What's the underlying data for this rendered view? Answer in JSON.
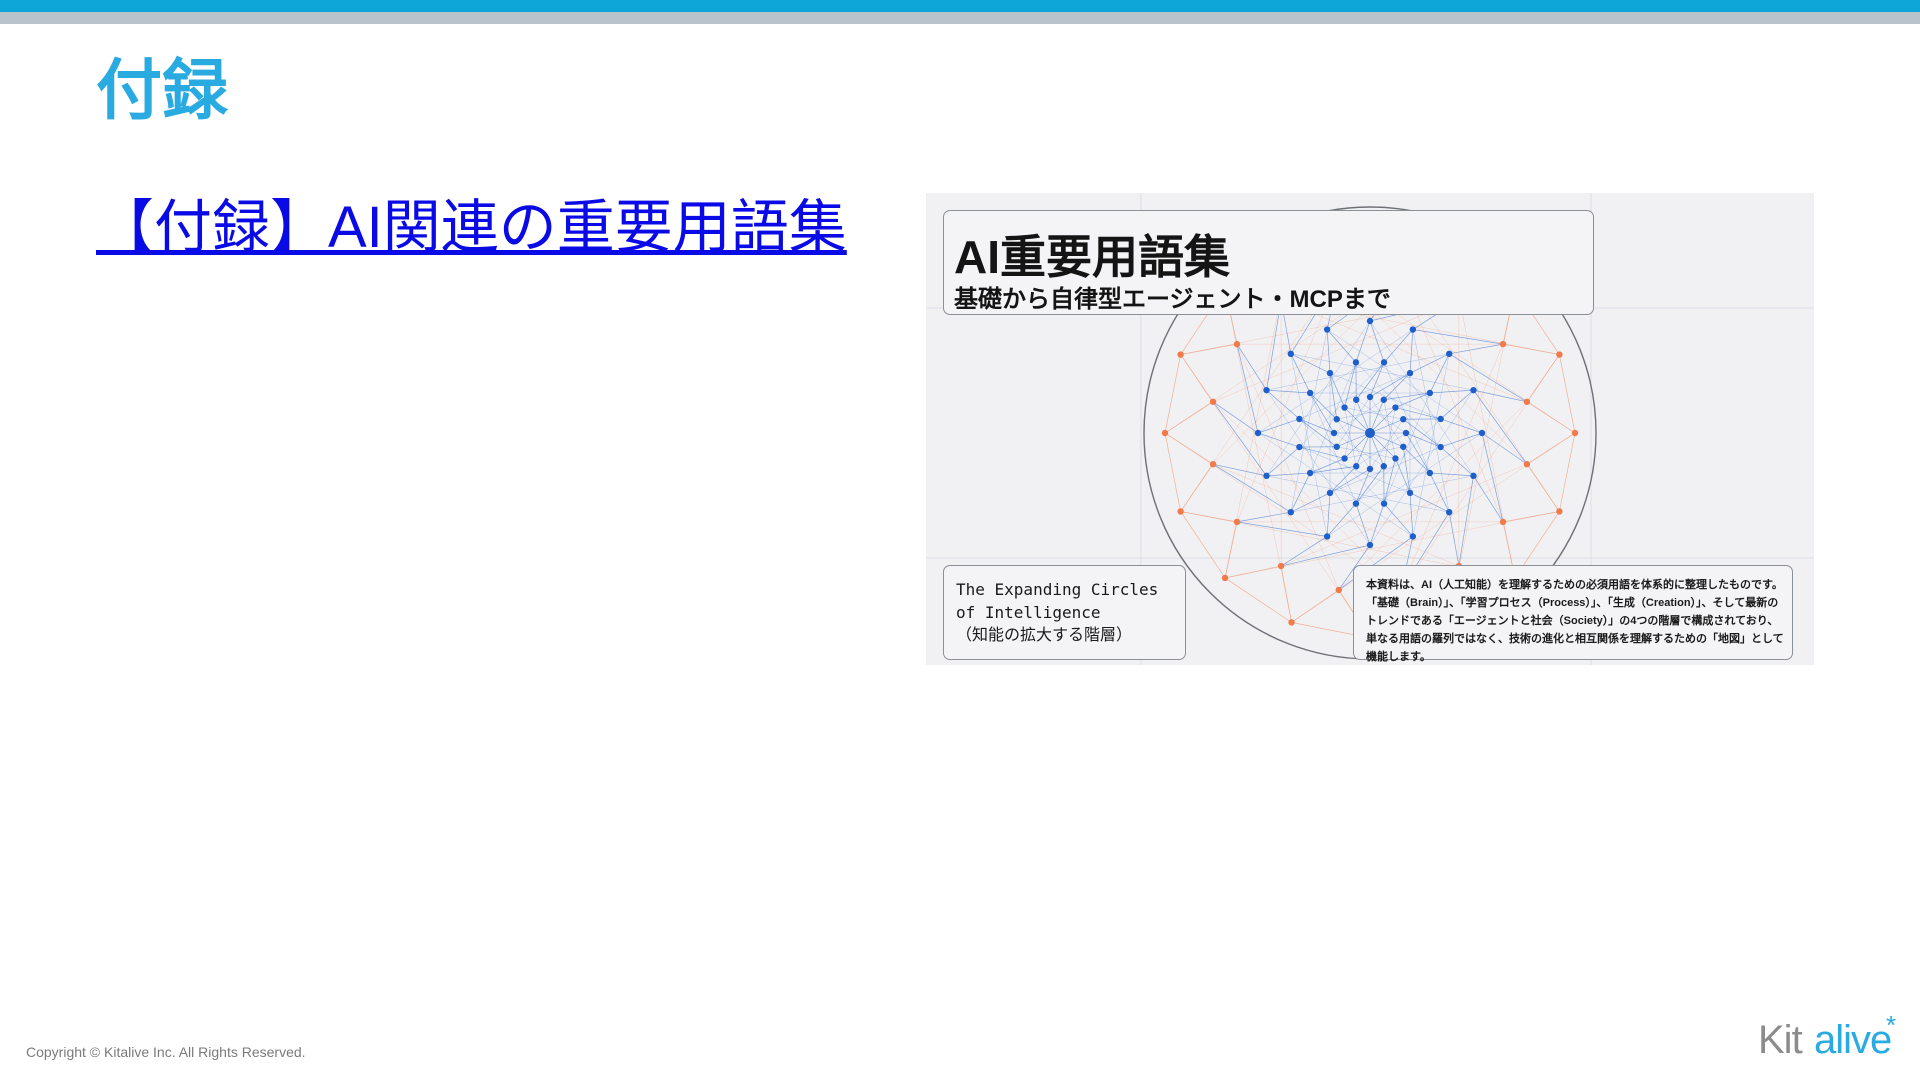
{
  "slide": {
    "title": "付録",
    "link_text": "【付録】AI関連の重要用語集"
  },
  "thumbnail": {
    "title": "AI重要用語集",
    "subtitle": "基礎から自律型エージェント・MCPまで",
    "circles_line1": "The Expanding Circles",
    "circles_line2": "of Intelligence",
    "circles_line3": "（知能の拡大する階層）",
    "description": "本資料は、AI（人工知能）を理解するための必須用語を体系的に整理したものです。「基礎（Brain）」、「学習プロセス（Process）」、「生成（Creation）」、そして最新のトレンドである「エージェントと社会（Society）」の4つの階層で構成されており、単なる用語の羅列ではなく、技術の進化と相互関係を理解するための「地図」として機能します。"
  },
  "footer": {
    "copyright": "Copyright © Kitalive Inc. All Rights Reserved.",
    "logo_part1": "Kit",
    "logo_part2": "alive",
    "logo_mark": "*"
  },
  "colors": {
    "accent": "#29abe2",
    "top_bar": "#0ea5d8",
    "top_bar_gray": "#b8c3cb",
    "link": "#0a0ae6",
    "network_blue": "#1f5fc9",
    "network_orange": "#f07a4a"
  }
}
